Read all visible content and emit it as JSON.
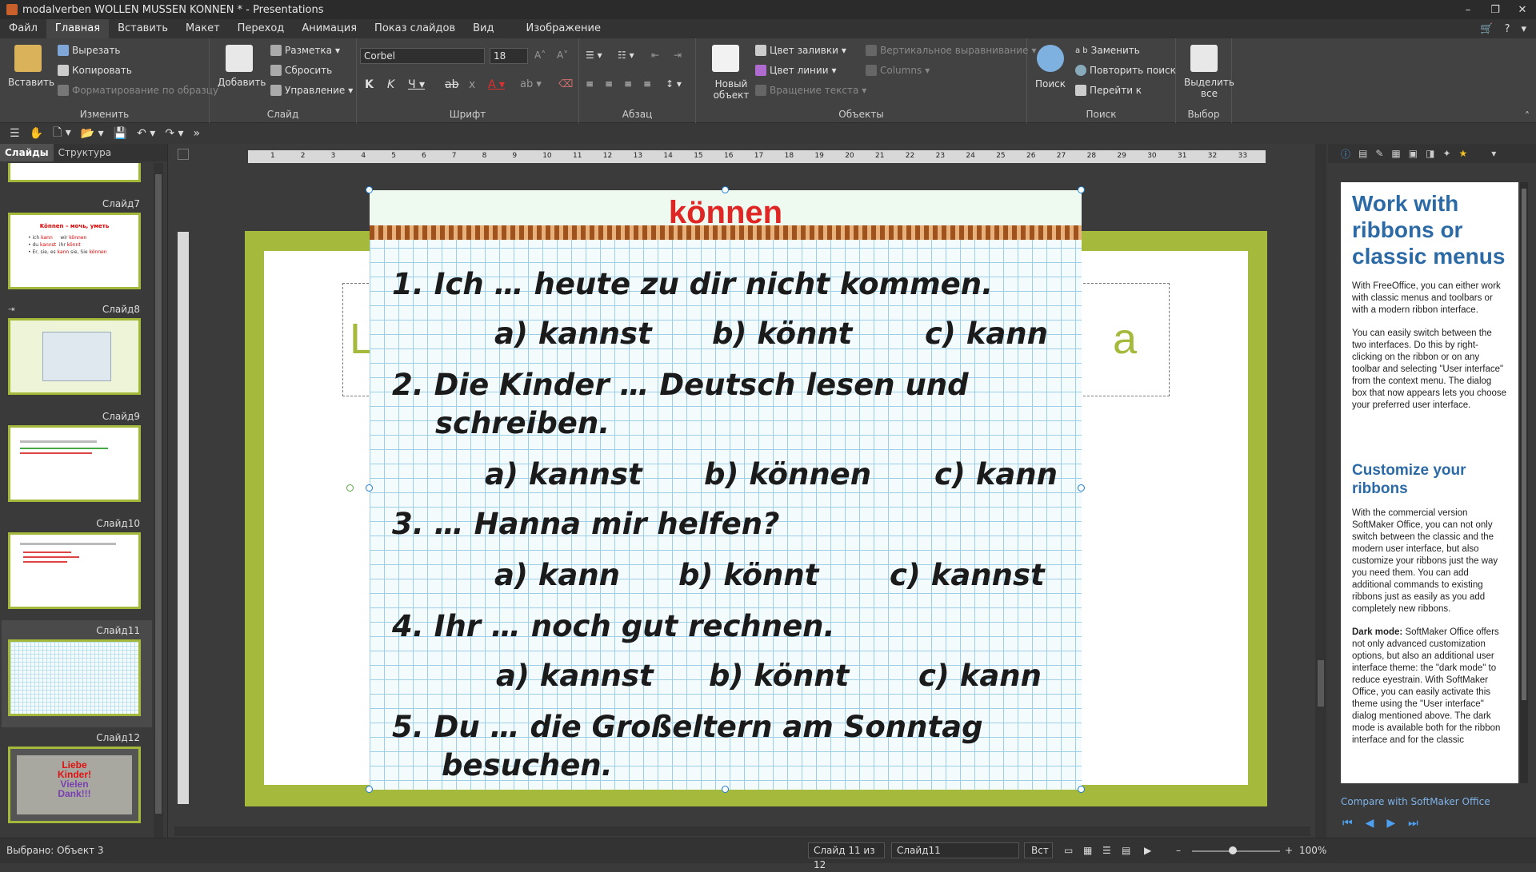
{
  "window": {
    "title": "modalverben WOLLEN MUSSEN KONNEN * - Presentations"
  },
  "menu": [
    "Файл",
    "Главная",
    "Вставить",
    "Макет",
    "Переход",
    "Анимация",
    "Показ слайдов",
    "Вид",
    "Изображение"
  ],
  "ribbon": {
    "paste": "Вставить",
    "cut": "Вырезать",
    "copy": "Копировать",
    "format_painter": "Форматирование по образцу",
    "group_edit": "Изменить",
    "add": "Добавить",
    "layout": "Разметка",
    "reset": "Сбросить",
    "control": "Управление",
    "group_slide": "Слайд",
    "font_name": "Corbel",
    "font_size": "18",
    "group_font": "Шрифт",
    "group_paragraph": "Абзац",
    "new_object": "Новый объект",
    "fill_color": "Цвет заливки",
    "line_color": "Цвет линии",
    "rotate_text": "Вращение текста",
    "vertical_align": "Вертикальное выравнивание",
    "columns": "Columns",
    "group_objects": "Объекты",
    "search": "Поиск",
    "replace": "Заменить",
    "repeat_search": "Повторить поиск",
    "goto": "Перейти к",
    "group_search": "Поиск",
    "select_all": "Выделить все",
    "group_select": "Выбор"
  },
  "panel_tabs": [
    "Слайды",
    "Структура"
  ],
  "slides": [
    {
      "label": "Слайд7"
    },
    {
      "label": "Слайд8"
    },
    {
      "label": "Слайд9"
    },
    {
      "label": "Слайд10"
    },
    {
      "label": "Слайд11"
    },
    {
      "label": "Слайд12"
    }
  ],
  "thumb_text": {
    "s7_title": "Können – мочь, уметь",
    "s12_line1": "Liebe",
    "s12_line2": "Kinder!",
    "s12_line3": "Vielen",
    "s12_line4": "Dank!!!"
  },
  "slide": {
    "ghost_left": "L",
    "ghost_right": "a",
    "worksheet_title": "können",
    "questions": [
      {
        "q": "1. Ich … heute zu dir nicht kommen.",
        "a": "a) kannst",
        "b": "b) könnt",
        "c": "c) kann"
      },
      {
        "q": "2. Die Kinder … Deutsch lesen und",
        "q2": "schreiben.",
        "a": "a) kannst",
        "b": "b) können",
        "c": "c) kann"
      },
      {
        "q": "3. … Hanna mir helfen?",
        "a": "a) kann",
        "b": "b) könnt",
        "c": "c) kannst"
      },
      {
        "q": "4. Ihr … noch gut rechnen.",
        "a": "a) kannst",
        "b": "b) könnt",
        "c": "c) kann"
      },
      {
        "q": "5. Du … die Großeltern am Sonntag",
        "q2": "besuchen."
      }
    ]
  },
  "ruler_numbers": [
    "1",
    "2",
    "3",
    "4",
    "5",
    "6",
    "7",
    "8",
    "9",
    "10",
    "11",
    "12",
    "13",
    "14",
    "15",
    "16",
    "17",
    "18",
    "19",
    "20",
    "21",
    "22",
    "23",
    "24",
    "25",
    "26",
    "27",
    "28",
    "29",
    "30",
    "31",
    "32",
    "33"
  ],
  "help": {
    "h1": "Work with ribbons or classic menus",
    "p1": "With FreeOffice, you can either work with classic menus and toolbars or with a modern ribbon interface.",
    "p2": "You can easily switch between the two interfaces. Do this by right-clicking on the ribbon or on any toolbar and selecting \"User interface\" from the context menu. The dialog box that now appears lets you choose your preferred user interface.",
    "h2": "Customize your ribbons",
    "p3": "With the commercial version SoftMaker Office, you can not only switch between the classic and the modern user interface, but also customize your ribbons just the way you need them. You can add additional commands to existing ribbons just as easily as you add completely new ribbons.",
    "p4_bold": "Dark mode:",
    "p4": " SoftMaker Office offers not only advanced customization options, but also an additional user interface theme: the \"dark mode\" to reduce eyestrain. With SoftMaker Office, you can easily activate this theme using the \"User interface\" dialog mentioned above. The dark mode is available both for the ribbon interface and for the classic",
    "link": "Compare with SoftMaker Office"
  },
  "status": {
    "selected": "Выбрано: Объект 3",
    "slide_of": "Слайд 11 из 12",
    "slide_name": "Слайд11",
    "mode": "Вст",
    "zoom": "100%"
  },
  "colors": {
    "accent": "#a5ba3c",
    "title_red": "#e02525",
    "help_blue": "#2c6aa6"
  }
}
